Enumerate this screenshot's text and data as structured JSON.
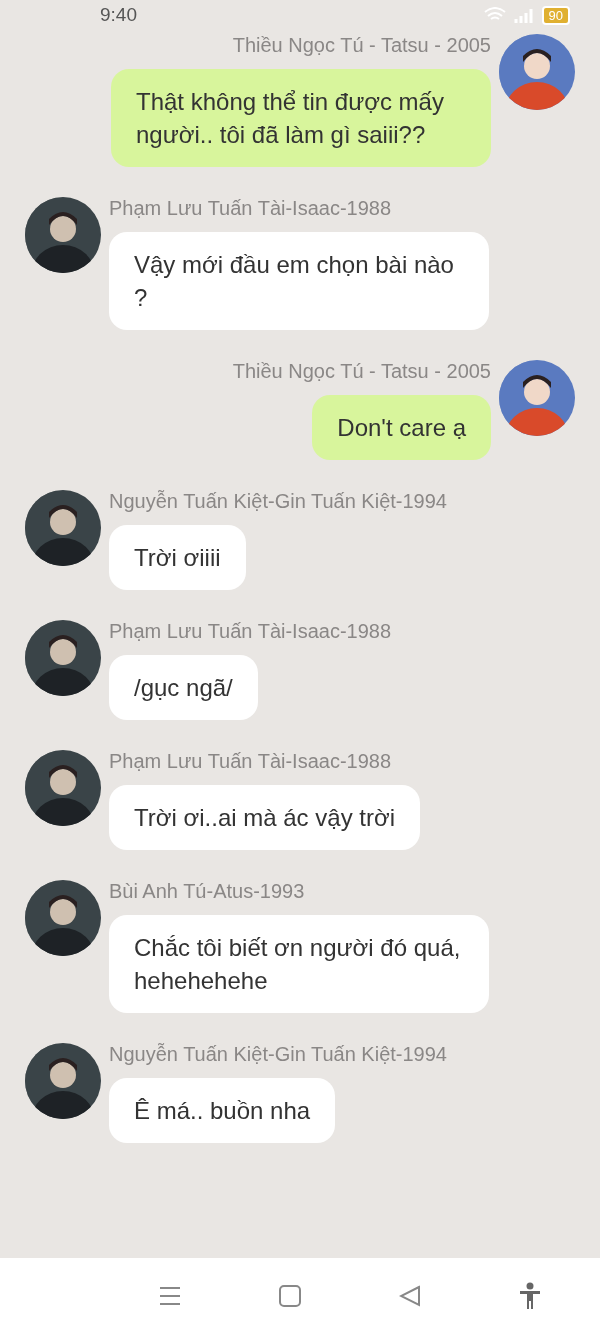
{
  "status_bar": {
    "time": "9:40",
    "battery": "90"
  },
  "messages": [
    {
      "kind": "outgoing",
      "sender": "Thiều Ngọc Tú - Tatsu - 2005",
      "text": "Thật không thể tin được mấy người.. tôi đã làm gì saiii??"
    },
    {
      "kind": "incoming",
      "sender": "Phạm Lưu Tuấn Tài-Isaac-1988",
      "text": "Vậy mới đầu em chọn bài nào ?"
    },
    {
      "kind": "outgoing",
      "sender": "Thiều Ngọc Tú - Tatsu - 2005",
      "text": "Don't care ạ"
    },
    {
      "kind": "incoming",
      "sender": "Nguyễn Tuấn Kiệt-Gin Tuấn Kiệt-1994",
      "text": "Trời ơiiii"
    },
    {
      "kind": "incoming",
      "sender": "Phạm Lưu Tuấn Tài-Isaac-1988",
      "text": "/gục ngã/"
    },
    {
      "kind": "incoming",
      "sender": "Phạm Lưu Tuấn Tài-Isaac-1988",
      "text": "Trời ơi..ai mà ác vậy trời"
    },
    {
      "kind": "incoming",
      "sender": "Bùi Anh Tú-Atus-1993",
      "text": "Chắc tôi biết ơn người đó quá, hehehehehe"
    },
    {
      "kind": "incoming",
      "sender": "Nguyễn Tuấn Kiệt-Gin Tuấn Kiệt-1994",
      "text": "Ê má.. buồn nha"
    }
  ]
}
